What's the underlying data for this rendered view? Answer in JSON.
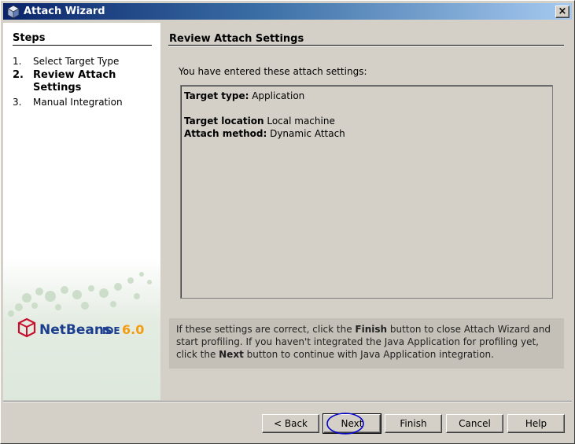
{
  "window": {
    "title": "Attach Wizard",
    "close_label": "×"
  },
  "steps": {
    "header": "Steps",
    "items": [
      {
        "num": "1.",
        "label": "Select Target Type",
        "active": false
      },
      {
        "num": "2.",
        "label": "Review Attach Settings",
        "active": true
      },
      {
        "num": "3.",
        "label": "Manual Integration",
        "active": false
      }
    ]
  },
  "logo": {
    "brand": "NetBeans",
    "ide": "IDE",
    "version": "6.0"
  },
  "main": {
    "header": "Review Attach Settings",
    "intro": "You have entered these attach settings:",
    "settings": {
      "target_type_label": "Target type:",
      "target_type_value": "Application",
      "target_location_label": "Target location",
      "target_location_value": "Local machine",
      "attach_method_label": "Attach method:",
      "attach_method_value": "Dynamic Attach"
    },
    "info": {
      "part1": "If these settings are correct, click the ",
      "finish_word": "Finish",
      "part2": " button to close Attach Wizard and start profiling. If you haven't integrated the Java Application for profiling yet, click the ",
      "next_word": "Next",
      "part3": " button to continue with Java Application integration."
    }
  },
  "buttons": {
    "back": "< Back",
    "next": "Next",
    "finish": "Finish",
    "cancel": "Cancel",
    "help": "Help"
  },
  "colors": {
    "title_start": "#0a246a",
    "title_end": "#a6caf0",
    "dialog_bg": "#d4d0c8",
    "highlight_ellipse": "#0000cc",
    "logo_red": "#c8102e",
    "logo_blue": "#1b3e8f",
    "logo_orange": "#f39c12"
  }
}
